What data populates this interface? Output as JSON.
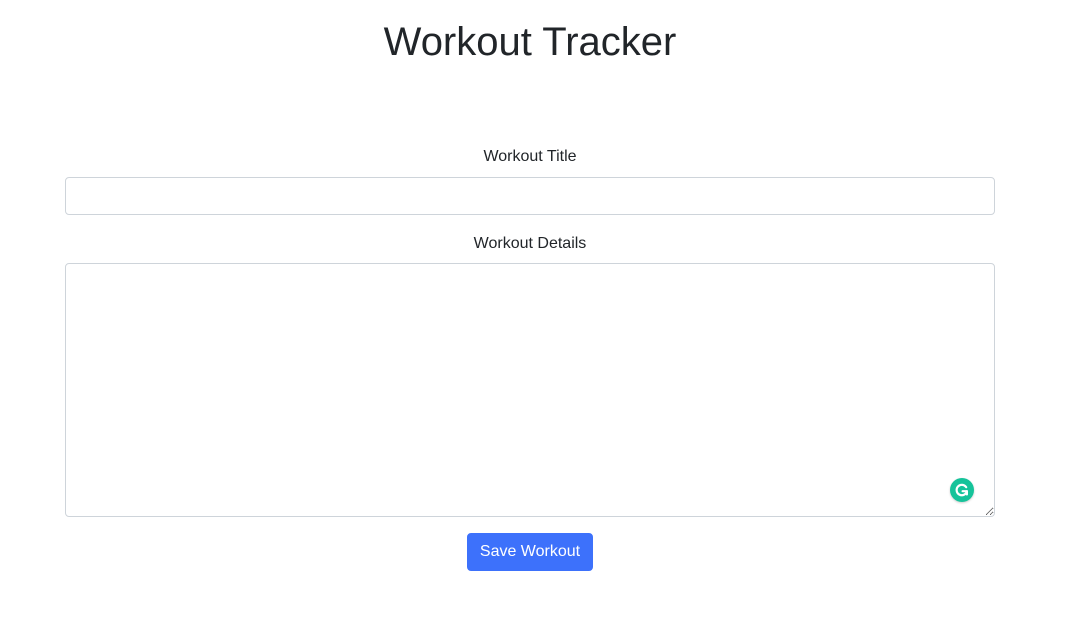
{
  "page": {
    "title": "Workout Tracker"
  },
  "form": {
    "title_label": "Workout Title",
    "title_value": "",
    "title_placeholder": "",
    "details_label": "Workout Details",
    "details_value": "",
    "details_placeholder": "",
    "save_label": "Save Workout"
  },
  "icons": {
    "grammarly": "grammarly-icon"
  },
  "colors": {
    "primary": "#3d71fb",
    "grammarly": "#15c39a",
    "text": "#212529",
    "border": "#ced4da"
  }
}
